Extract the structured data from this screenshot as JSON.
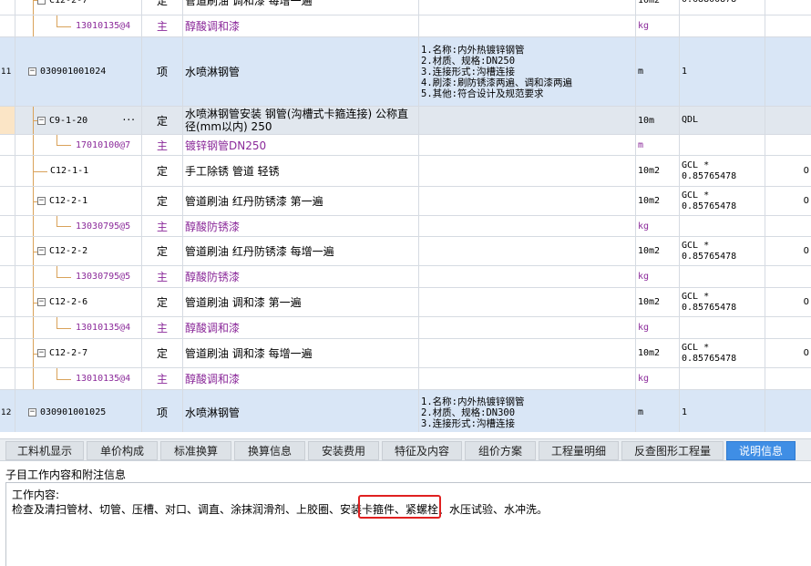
{
  "grid": {
    "rows": [
      {
        "num": "",
        "code": "C12-2-7",
        "type": "定",
        "name": "管道刷油 调和漆 每增一遍",
        "feat": [],
        "unit": "10m2",
        "qty": [
          "0.68800878"
        ],
        "extra": ""
      },
      {
        "num": "",
        "code": "13010135@4",
        "type": "主",
        "name": "醇酸调和漆",
        "feat": [],
        "unit": "kg",
        "qty": [],
        "extra": ""
      },
      {
        "num": "11",
        "code": "030901001024",
        "type": "项",
        "name": "水喷淋钢管",
        "feat": [
          "1.名称:内外热镀锌钢管",
          "2.材质、规格:DN250",
          "3.连接形式:沟槽连接",
          "4.刷漆:刷防锈漆两遍、调和漆两遍",
          "5.其他:符合设计及规范要求"
        ],
        "unit": "m",
        "qty": [
          "1"
        ],
        "extra": ""
      },
      {
        "num": "",
        "code": "C9-1-20",
        "type": "定",
        "name": "水喷淋钢管安装 钢管(沟槽式卡箍连接) 公称直径(mm以内) 250",
        "feat": [],
        "unit": "10m",
        "qty": [
          "QDL"
        ],
        "extra": "",
        "more": "···"
      },
      {
        "num": "",
        "code": "17010100@7",
        "type": "主",
        "name": "镀锌钢管DN250",
        "feat": [],
        "unit": "m",
        "qty": [],
        "extra": ""
      },
      {
        "num": "",
        "code": "C12-1-1",
        "type": "定",
        "name": "手工除锈 管道 轻锈",
        "feat": [],
        "unit": "10m2",
        "qty": [
          "GCL *",
          "0.85765478"
        ],
        "extra": "0"
      },
      {
        "num": "",
        "code": "C12-2-1",
        "type": "定",
        "name": "管道刷油 红丹防锈漆 第一遍",
        "feat": [],
        "unit": "10m2",
        "qty": [
          "GCL *",
          "0.85765478"
        ],
        "extra": "0"
      },
      {
        "num": "",
        "code": "13030795@5",
        "type": "主",
        "name": "醇酸防锈漆",
        "feat": [],
        "unit": "kg",
        "qty": [],
        "extra": ""
      },
      {
        "num": "",
        "code": "C12-2-2",
        "type": "定",
        "name": "管道刷油 红丹防锈漆 每增一遍",
        "feat": [],
        "unit": "10m2",
        "qty": [
          "GCL *",
          "0.85765478"
        ],
        "extra": "0"
      },
      {
        "num": "",
        "code": "13030795@5",
        "type": "主",
        "name": "醇酸防锈漆",
        "feat": [],
        "unit": "kg",
        "qty": [],
        "extra": ""
      },
      {
        "num": "",
        "code": "C12-2-6",
        "type": "定",
        "name": "管道刷油 调和漆 第一遍",
        "feat": [],
        "unit": "10m2",
        "qty": [
          "GCL *",
          "0.85765478"
        ],
        "extra": "0"
      },
      {
        "num": "",
        "code": "13010135@4",
        "type": "主",
        "name": "醇酸调和漆",
        "feat": [],
        "unit": "kg",
        "qty": [],
        "extra": ""
      },
      {
        "num": "",
        "code": "C12-2-7",
        "type": "定",
        "name": "管道刷油 调和漆 每增一遍",
        "feat": [],
        "unit": "10m2",
        "qty": [
          "GCL *",
          "0.85765478"
        ],
        "extra": "0"
      },
      {
        "num": "",
        "code": "13010135@4",
        "type": "主",
        "name": "醇酸调和漆",
        "feat": [],
        "unit": "kg",
        "qty": [],
        "extra": ""
      },
      {
        "num": "12",
        "code": "030901001025",
        "type": "项",
        "name": "水喷淋钢管",
        "feat": [
          "1.名称:内外热镀锌钢管",
          "2.材质、规格:DN300",
          "3.连接形式:沟槽连接"
        ],
        "unit": "m",
        "qty": [
          "1"
        ],
        "extra": ""
      }
    ]
  },
  "tabs": [
    "工料机显示",
    "单价构成",
    "标准换算",
    "换算信息",
    "安装费用",
    "特征及内容",
    "组价方案",
    "工程量明细",
    "反查图形工程量",
    "说明信息"
  ],
  "active_tab": "说明信息",
  "panel": {
    "title": "子目工作内容和附注信息",
    "heading": "工作内容:",
    "body": "检查及清扫管材、切管、压槽、对口、调直、涂抹润滑剂、上胶圈、安装卡箍件、紧螺栓、水压试验、水冲洗。"
  },
  "colors": {
    "qd_row": "#d9e6f6",
    "purple_text": "#8b2a9a",
    "active_tab": "#3f8ee5",
    "highlight": "#e02020"
  }
}
